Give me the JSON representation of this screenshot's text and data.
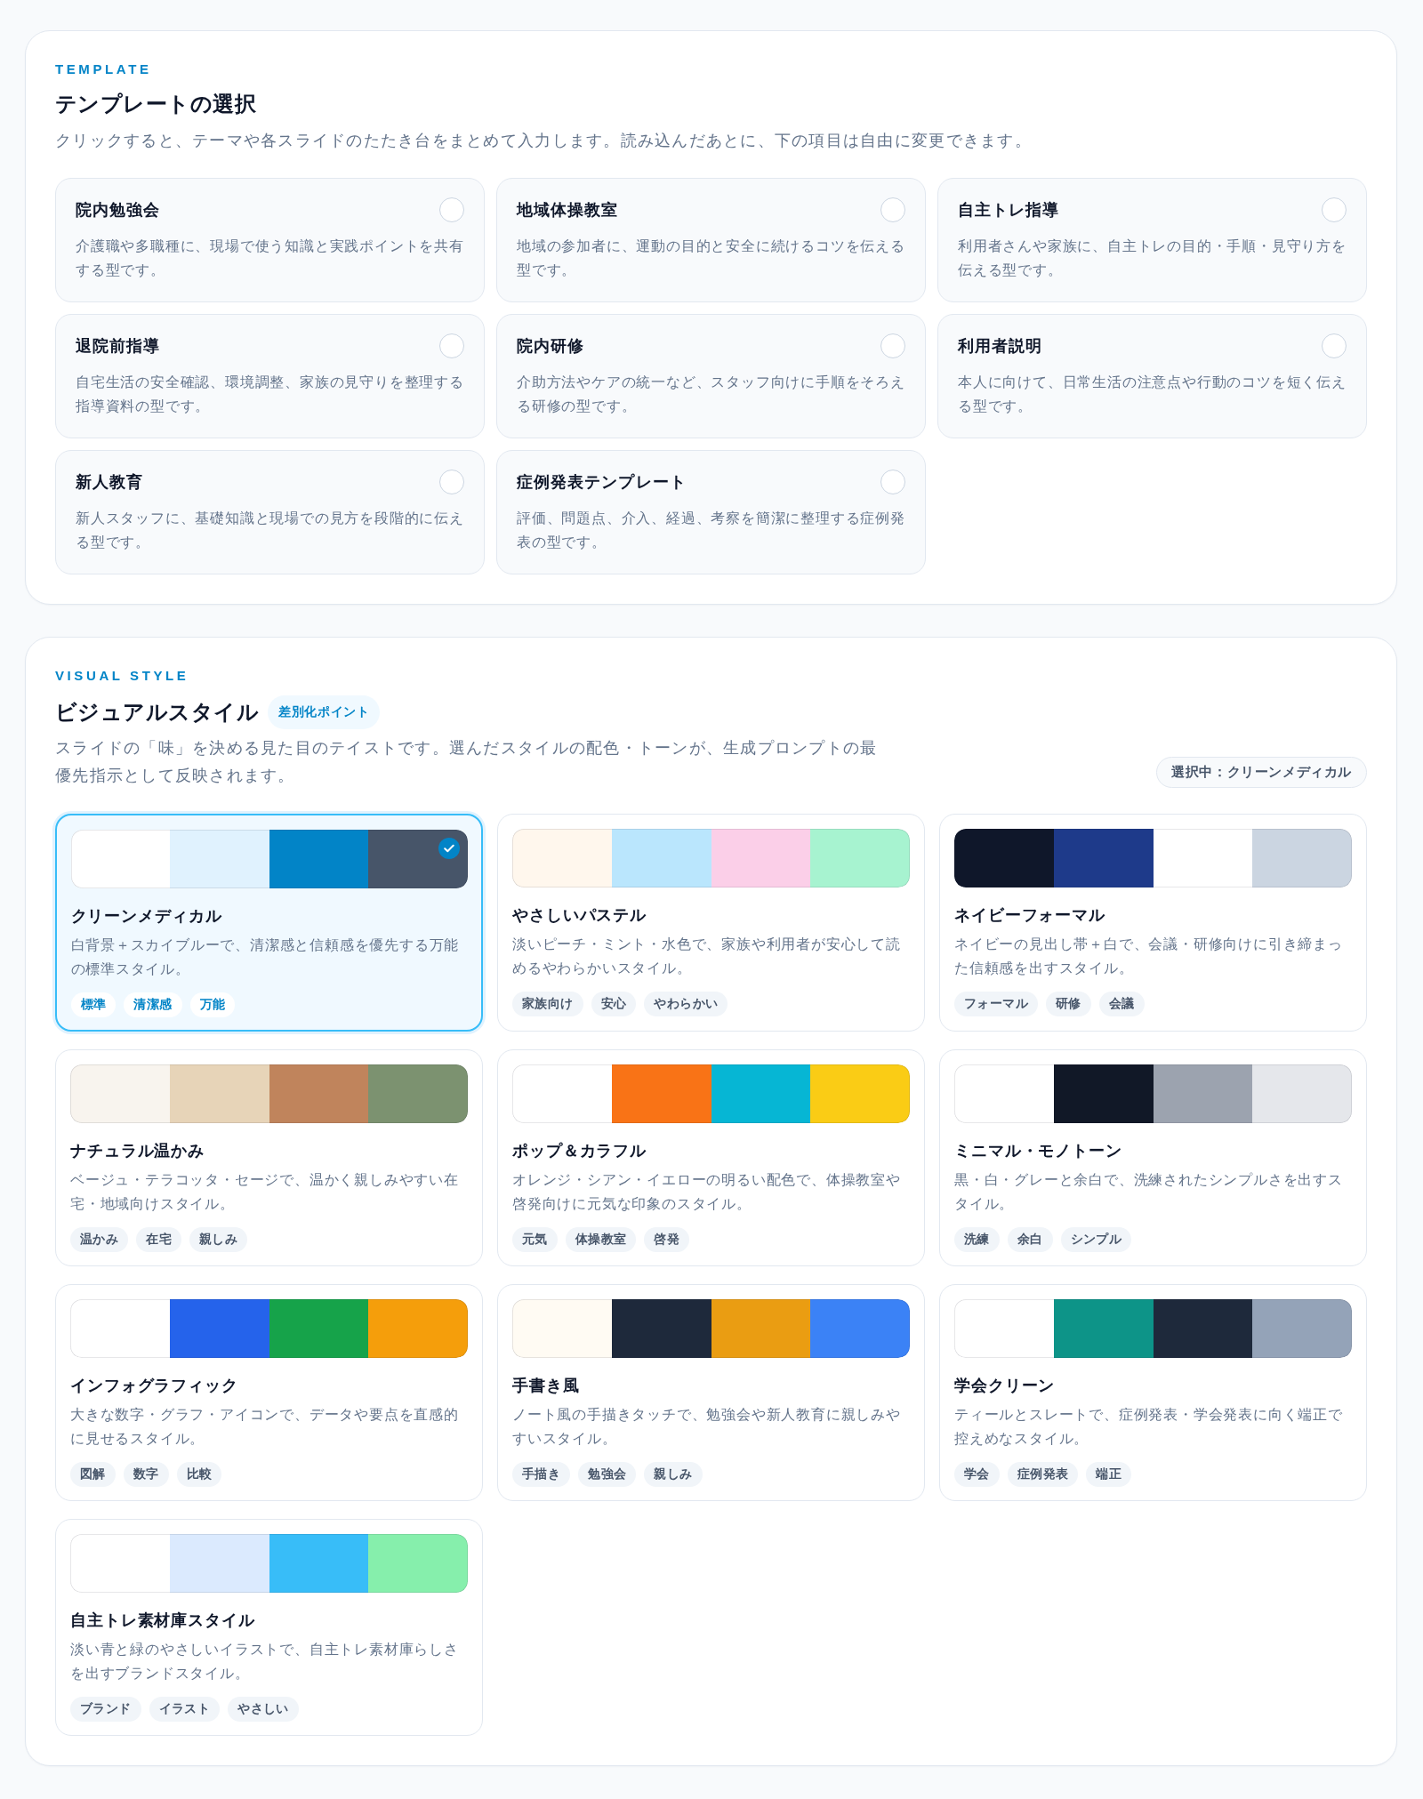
{
  "template_section": {
    "eyebrow": "TEMPLATE",
    "title": "テンプレートの選択",
    "description": "クリックすると、テーマや各スライドのたたき台をまとめて入力します。読み込んだあとに、下の項目は自由に変更できます。",
    "templates": [
      {
        "title": "院内勉強会",
        "description": "介護職や多職種に、現場で使う知識と実践ポイントを共有する型です。",
        "selected": false
      },
      {
        "title": "地域体操教室",
        "description": "地域の参加者に、運動の目的と安全に続けるコツを伝える型です。",
        "selected": false
      },
      {
        "title": "自主トレ指導",
        "description": "利用者さんや家族に、自主トレの目的・手順・見守り方を伝える型です。",
        "selected": false
      },
      {
        "title": "退院前指導",
        "description": "自宅生活の安全確認、環境調整、家族の見守りを整理する指導資料の型です。",
        "selected": false
      },
      {
        "title": "院内研修",
        "description": "介助方法やケアの統一など、スタッフ向けに手順をそろえる研修の型です。",
        "selected": false
      },
      {
        "title": "利用者説明",
        "description": "本人に向けて、日常生活の注意点や行動のコツを短く伝える型です。",
        "selected": false
      },
      {
        "title": "新人教育",
        "description": "新人スタッフに、基礎知識と現場での見方を段階的に伝える型です。",
        "selected": false
      },
      {
        "title": "症例発表テンプレート",
        "description": "評価、問題点、介入、経過、考察を簡潔に整理する症例発表の型です。",
        "selected": false
      }
    ]
  },
  "visual_style_section": {
    "eyebrow": "VISUAL STYLE",
    "title": "ビジュアルスタイル",
    "badge": "差別化ポイント",
    "description": "スライドの「味」を決める見た目のテイストです。選んだスタイルの配色・トーンが、生成プロンプトの最優先指示として反映されます。",
    "selection_status": "選択中：クリーンメディカル",
    "styles": [
      {
        "title": "クリーンメディカル",
        "description": "白背景＋スカイブルーで、清潔感と信頼感を優先する万能の標準スタイル。",
        "selected": true,
        "palette": [
          {
            "color": "#ffffff"
          },
          {
            "color": "#e0f2fe"
          },
          {
            "color": "#0284c7"
          },
          {
            "color": "#475569"
          }
        ],
        "tags": [
          "標準",
          "清潔感",
          "万能"
        ]
      },
      {
        "title": "やさしいパステル",
        "description": "淡いピーチ・ミント・水色で、家族や利用者が安心して読めるやわらかいスタイル。",
        "selected": false,
        "palette": [
          {
            "color": "#fff7ed"
          },
          {
            "color": "#bae6fd"
          },
          {
            "color": "#fbcfe8"
          },
          {
            "color": "#a7f3d0"
          }
        ],
        "tags": [
          "家族向け",
          "安心",
          "やわらかい"
        ]
      },
      {
        "title": "ネイビーフォーマル",
        "description": "ネイビーの見出し帯＋白で、会議・研修向けに引き締まった信頼感を出すスタイル。",
        "selected": false,
        "palette": [
          {
            "color": "#0f172a"
          },
          {
            "color": "#1e3a8a"
          },
          {
            "color": "#ffffff"
          },
          {
            "color": "#cbd5e1"
          }
        ],
        "tags": [
          "フォーマル",
          "研修",
          "会議"
        ]
      },
      {
        "title": "ナチュラル温かみ",
        "description": "ベージュ・テラコッタ・セージで、温かく親しみやすい在宅・地域向けスタイル。",
        "selected": false,
        "palette": [
          {
            "color": "#f8f4ee"
          },
          {
            "color": "#e7d4b8"
          },
          {
            "color": "#c0845c"
          },
          {
            "color": "#7c9270"
          }
        ],
        "tags": [
          "温かみ",
          "在宅",
          "親しみ"
        ]
      },
      {
        "title": "ポップ＆カラフル",
        "description": "オレンジ・シアン・イエローの明るい配色で、体操教室や啓発向けに元気な印象のスタイル。",
        "selected": false,
        "palette": [
          {
            "color": "#ffffff"
          },
          {
            "color": "#f97316"
          },
          {
            "color": "#06b6d4"
          },
          {
            "color": "#facc15"
          }
        ],
        "tags": [
          "元気",
          "体操教室",
          "啓発"
        ]
      },
      {
        "title": "ミニマル・モノトーン",
        "description": "黒・白・グレーと余白で、洗練されたシンプルさを出すスタイル。",
        "selected": false,
        "palette": [
          {
            "color": "#ffffff"
          },
          {
            "color": "#111827"
          },
          {
            "color": "#9ca3af"
          },
          {
            "color": "#e5e7eb"
          }
        ],
        "tags": [
          "洗練",
          "余白",
          "シンプル"
        ]
      },
      {
        "title": "インフォグラフィック",
        "description": "大きな数字・グラフ・アイコンで、データや要点を直感的に見せるスタイル。",
        "selected": false,
        "palette": [
          {
            "color": "#ffffff"
          },
          {
            "color": "#2563eb"
          },
          {
            "color": "#16a34a"
          },
          {
            "color": "#f59e0b"
          }
        ],
        "tags": [
          "図解",
          "数字",
          "比較"
        ]
      },
      {
        "title": "手書き風",
        "description": "ノート風の手描きタッチで、勉強会や新人教育に親しみやすいスタイル。",
        "selected": false,
        "palette": [
          {
            "color": "#fffbf3"
          },
          {
            "color": "#1e293b"
          },
          {
            "color": "#ea9d12"
          },
          {
            "color": "#3b82f6"
          }
        ],
        "tags": [
          "手描き",
          "勉強会",
          "親しみ"
        ]
      },
      {
        "title": "学会クリーン",
        "description": "ティールとスレートで、症例発表・学会発表に向く端正で控えめなスタイル。",
        "selected": false,
        "palette": [
          {
            "color": "#ffffff"
          },
          {
            "color": "#0d9488"
          },
          {
            "color": "#1e293b"
          },
          {
            "color": "#94a3b8"
          }
        ],
        "tags": [
          "学会",
          "症例発表",
          "端正"
        ]
      },
      {
        "title": "自主トレ素材庫スタイル",
        "description": "淡い青と緑のやさしいイラストで、自主トレ素材庫らしさを出すブランドスタイル。",
        "selected": false,
        "palette": [
          {
            "color": "#ffffff"
          },
          {
            "color": "#dbeafe"
          },
          {
            "color": "#38bdf8"
          },
          {
            "color": "#86efac"
          }
        ],
        "tags": [
          "ブランド",
          "イラスト",
          "やさしい"
        ]
      }
    ]
  }
}
